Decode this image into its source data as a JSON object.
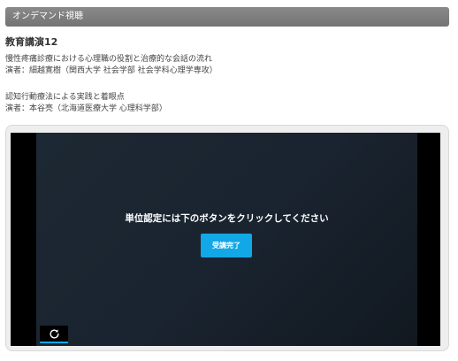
{
  "header": {
    "title": "オンデマンド視聴"
  },
  "lecture": {
    "title": "教育講演12",
    "talks": [
      {
        "title": "慢性疼痛診療における心理職の役割と治療的な会話の流れ",
        "speaker": "演者：細越寛樹（関西大学 社会学部 社会学科心理学専攻）"
      },
      {
        "title": "認知行動療法による実践と着眼点",
        "speaker": "演者：本谷亮（北海道医療大学 心理科学部）"
      }
    ]
  },
  "player": {
    "prompt": "単位認定には下のボタンをクリックしてください",
    "complete_button_label": "受講完了",
    "replay_icon": "replay-icon"
  },
  "colors": {
    "header_bar": "#7f7f7f",
    "accent": "#12a7e6",
    "video_background": "#1a2430"
  }
}
